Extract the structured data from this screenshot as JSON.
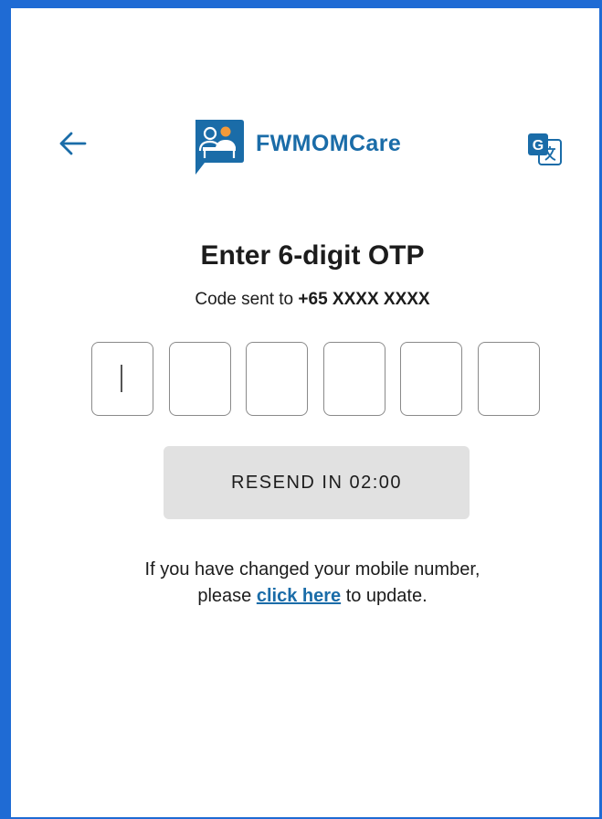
{
  "header": {
    "back_icon": "arrow-left-icon",
    "app_name": "FWMOMCare",
    "logo_icon": "people-chat-logo",
    "translate_icon": "google-translate-icon",
    "brand_color": "#1a6ca8"
  },
  "otp": {
    "title": "Enter 6-digit OTP",
    "code_sent_prefix": "Code sent to",
    "phone_number": "+65 XXXX XXXX",
    "digits": [
      "",
      "",
      "",
      "",
      "",
      ""
    ]
  },
  "resend": {
    "label": "RESEND IN 02:00"
  },
  "notice": {
    "line1": "If you have changed your mobile number,",
    "line2_prefix": "please",
    "link_text": "click here",
    "line2_suffix": "to update."
  }
}
